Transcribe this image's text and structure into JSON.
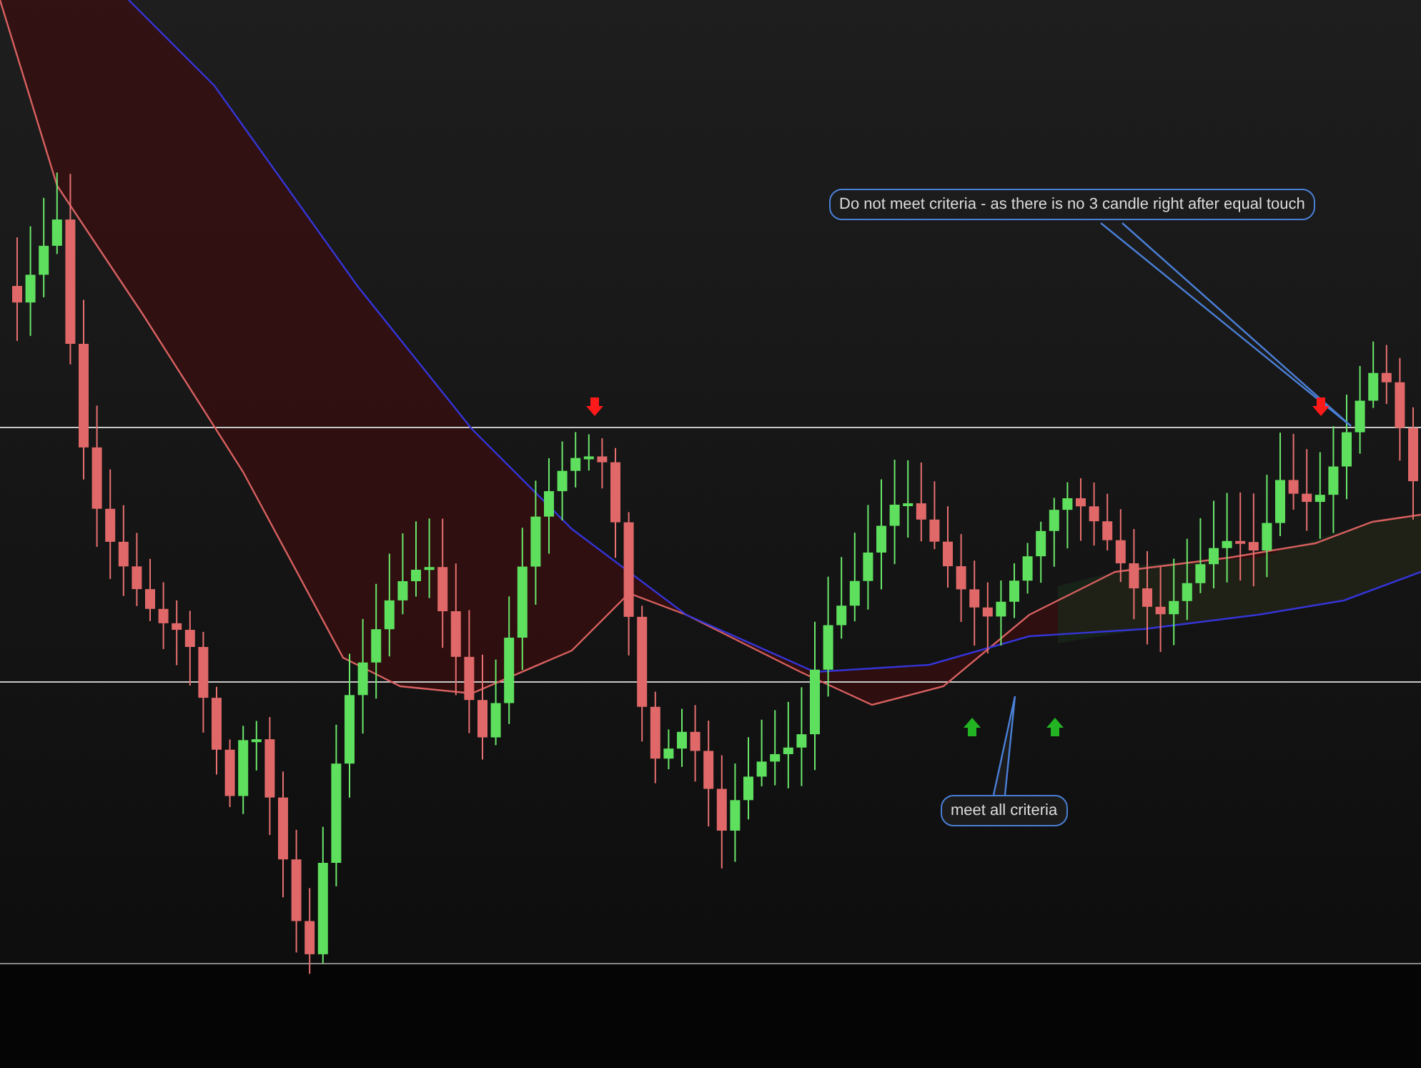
{
  "annotations": [
    {
      "text": "Do not meet criteria - as there is no 3 candle right after equal touch"
    },
    {
      "text": "meet all criteria"
    }
  ],
  "signals": [
    {
      "kind": "down"
    },
    {
      "kind": "up"
    },
    {
      "kind": "up"
    },
    {
      "kind": "down"
    }
  ]
}
